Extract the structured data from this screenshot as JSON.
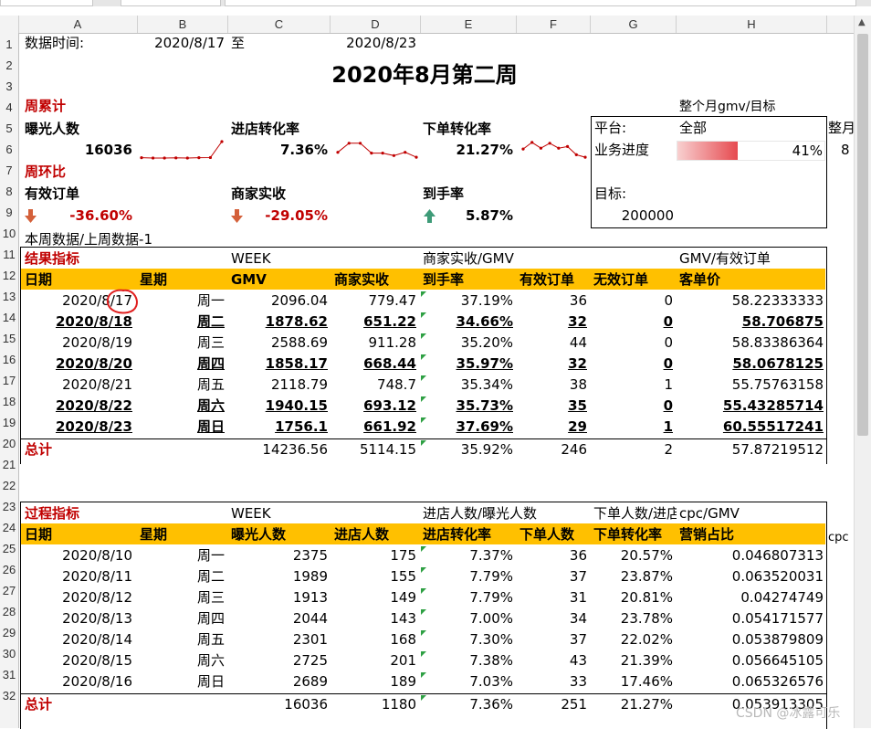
{
  "columns": [
    "A",
    "B",
    "C",
    "D",
    "E",
    "F",
    "G",
    "H"
  ],
  "rows": [
    "1",
    "2",
    "3",
    "4",
    "5",
    "6",
    "7",
    "8",
    "9",
    "10",
    "11",
    "12",
    "13",
    "14",
    "15",
    "16",
    "17",
    "18",
    "19",
    "20",
    "21",
    "22",
    "23",
    "24",
    "25",
    "26",
    "27",
    "28",
    "29",
    "30",
    "31",
    "32"
  ],
  "top": {
    "date_label": "数据时间:",
    "start_date": "2020/8/17",
    "to_label": "至",
    "end_date": "2020/8/23",
    "title": "2020年8月第二周"
  },
  "weekly": {
    "label": "周累计",
    "exposure_label": "曝光人数",
    "exposure_value": "16036",
    "store_rate_label": "进店转化率",
    "store_rate_value": "7.36%",
    "order_rate_label": "下单转化率",
    "order_rate_value": "21.27%"
  },
  "wow": {
    "label": "周环比",
    "valid_orders_label": "有效订单",
    "valid_orders_value": "-36.60%",
    "merchant_label": "商家实收",
    "merchant_value": "-29.05%",
    "arrival_label": "到手率",
    "arrival_value": "5.87%",
    "note": "本周数据/上周数据-1"
  },
  "panel": {
    "header": "整个月gmv/目标",
    "platform_label": "平台:",
    "platform_value": "全部",
    "progress_label": "业务进度",
    "progress_value": "41%",
    "progress_fraction": 0.41,
    "target_label": "目标:",
    "target_value": "200000",
    "clip1": "整月",
    "clip2": "8"
  },
  "results": {
    "section_label": "结果指标",
    "week_label": "WEEK",
    "merchant_gmv_label": "商家实收/GMV",
    "gmv_order_label": "GMV/有效订单",
    "headers": [
      "日期",
      "星期",
      "GMV",
      "商家实收",
      "到手率",
      "有效订单",
      "无效订单",
      "客单价"
    ],
    "rows": [
      {
        "date": "2020/8/17",
        "day": "周一",
        "gmv": "2096.04",
        "merchant": "779.47",
        "rate": "37.19%",
        "valid": "36",
        "invalid": "0",
        "avg": "58.22333333",
        "bold": false
      },
      {
        "date": "2020/8/18",
        "day": "周二",
        "gmv": "1878.62",
        "merchant": "651.22",
        "rate": "34.66%",
        "valid": "32",
        "invalid": "0",
        "avg": "58.706875",
        "bold": true
      },
      {
        "date": "2020/8/19",
        "day": "周三",
        "gmv": "2588.69",
        "merchant": "911.28",
        "rate": "35.20%",
        "valid": "44",
        "invalid": "0",
        "avg": "58.83386364",
        "bold": false
      },
      {
        "date": "2020/8/20",
        "day": "周四",
        "gmv": "1858.17",
        "merchant": "668.44",
        "rate": "35.97%",
        "valid": "32",
        "invalid": "0",
        "avg": "58.0678125",
        "bold": true
      },
      {
        "date": "2020/8/21",
        "day": "周五",
        "gmv": "2118.79",
        "merchant": "748.7",
        "rate": "35.34%",
        "valid": "38",
        "invalid": "1",
        "avg": "55.75763158",
        "bold": false
      },
      {
        "date": "2020/8/22",
        "day": "周六",
        "gmv": "1940.15",
        "merchant": "693.12",
        "rate": "35.73%",
        "valid": "35",
        "invalid": "0",
        "avg": "55.43285714",
        "bold": true
      },
      {
        "date": "2020/8/23",
        "day": "周日",
        "gmv": "1756.1",
        "merchant": "661.92",
        "rate": "37.69%",
        "valid": "29",
        "invalid": "1",
        "avg": "60.55517241",
        "bold": true
      }
    ],
    "total": {
      "label": "总计",
      "gmv": "14236.56",
      "merchant": "5114.15",
      "rate": "35.92%",
      "valid": "246",
      "invalid": "2",
      "avg": "57.87219512"
    }
  },
  "process": {
    "section_label": "过程指标",
    "week_label": "WEEK",
    "store_exposure_label": "进店人数/曝光人数",
    "order_store_label": "下单人数/进店",
    "cpc_gmv_label": "cpc/GMV",
    "clip": "cpc",
    "headers": [
      "日期",
      "星期",
      "曝光人数",
      "进店人数",
      "进店转化率",
      "下单人数",
      "下单转化率",
      "营销占比"
    ],
    "rows": [
      {
        "date": "2020/8/10",
        "day": "周一",
        "exp": "2375",
        "store": "175",
        "store_rate": "7.37%",
        "orders": "36",
        "order_rate": "20.57%",
        "mkt": "0.046807313"
      },
      {
        "date": "2020/8/11",
        "day": "周二",
        "exp": "1989",
        "store": "155",
        "store_rate": "7.79%",
        "orders": "37",
        "order_rate": "23.87%",
        "mkt": "0.063520031"
      },
      {
        "date": "2020/8/12",
        "day": "周三",
        "exp": "1913",
        "store": "149",
        "store_rate": "7.79%",
        "orders": "31",
        "order_rate": "20.81%",
        "mkt": "0.04274749"
      },
      {
        "date": "2020/8/13",
        "day": "周四",
        "exp": "2044",
        "store": "143",
        "store_rate": "7.00%",
        "orders": "34",
        "order_rate": "23.78%",
        "mkt": "0.054171577"
      },
      {
        "date": "2020/8/14",
        "day": "周五",
        "exp": "2301",
        "store": "168",
        "store_rate": "7.30%",
        "orders": "37",
        "order_rate": "22.02%",
        "mkt": "0.053879809"
      },
      {
        "date": "2020/8/15",
        "day": "周六",
        "exp": "2725",
        "store": "201",
        "store_rate": "7.38%",
        "orders": "43",
        "order_rate": "21.39%",
        "mkt": "0.056645105"
      },
      {
        "date": "2020/8/16",
        "day": "周日",
        "exp": "2689",
        "store": "189",
        "store_rate": "7.03%",
        "orders": "33",
        "order_rate": "17.46%",
        "mkt": "0.065326576"
      }
    ],
    "total": {
      "label": "总计",
      "exp": "16036",
      "store": "1180",
      "store_rate": "7.36%",
      "orders": "251",
      "order_rate": "21.27%",
      "mkt": "0.053913305"
    }
  },
  "sparklines": {
    "exposure": [
      0.02,
      0.0,
      0.0,
      0.01,
      0.0,
      0.02,
      0.03,
      1.0
    ],
    "store_rate": [
      0.35,
      0.9,
      0.9,
      0.3,
      0.3,
      0.15,
      0.35,
      0.05
    ],
    "order_rate": [
      0.55,
      0.95,
      0.6,
      0.9,
      0.6,
      0.7,
      0.2,
      0.05
    ]
  },
  "watermark": "CSDN @冰露可乐",
  "colors": {
    "header_fill": "#ffc000",
    "accent_red": "#c00000",
    "progress_start": "#f4b6b6",
    "progress_end": "#e8585c"
  }
}
